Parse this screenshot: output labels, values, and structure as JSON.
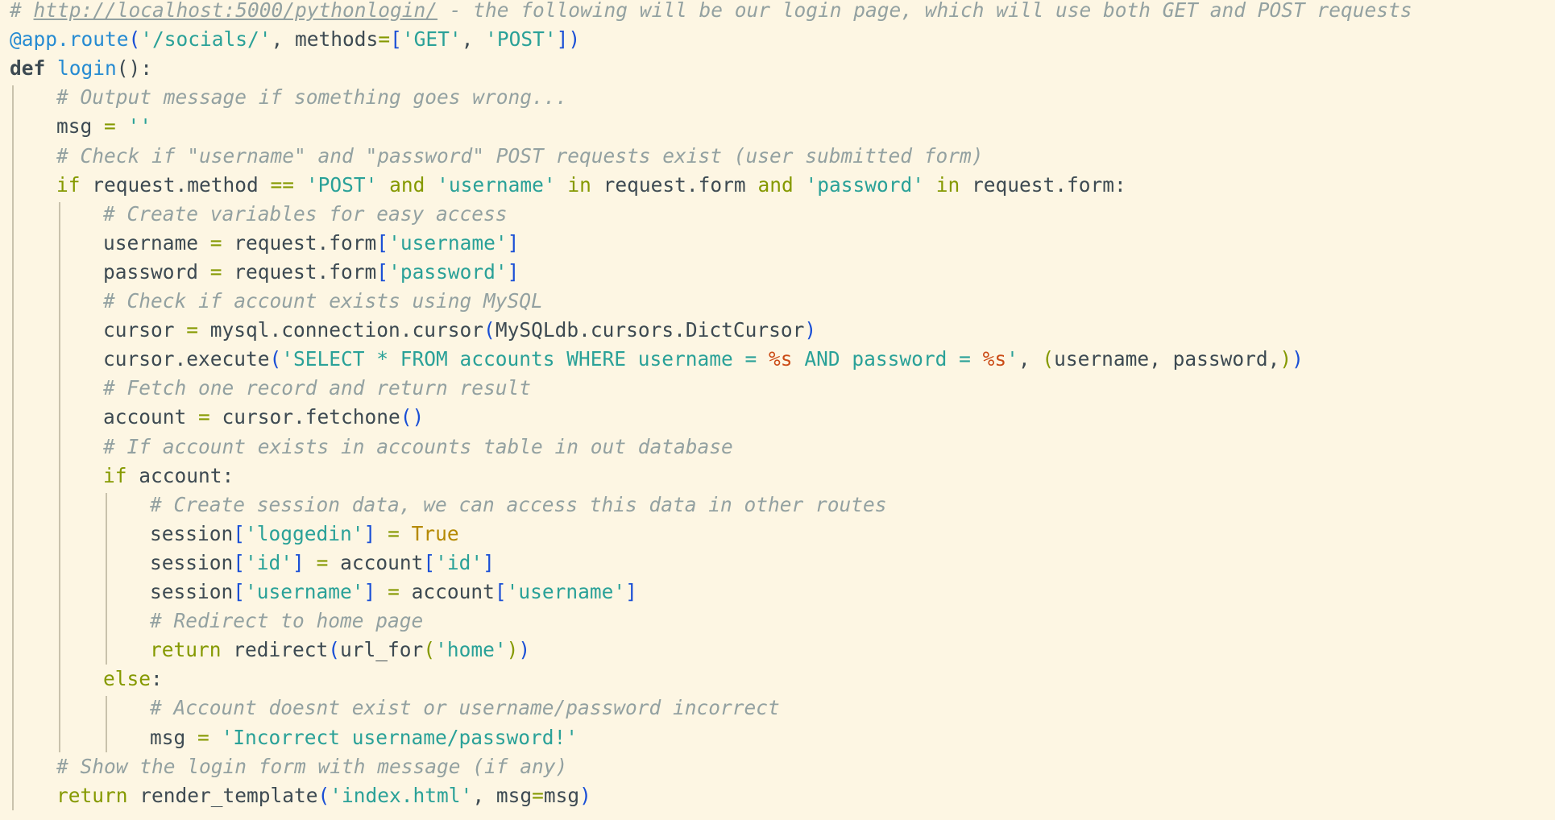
{
  "editor": {
    "language": "python",
    "theme": "solarized-light",
    "colors": {
      "background": "#fdf6e3",
      "comment": "#93a1a1",
      "keyword": "#859900",
      "string": "#2aa198",
      "function": "#268bd2",
      "format_specifier": "#cb4b16",
      "bracket": "#1a4fd6",
      "constant": "#b58900",
      "text": "#3d4a52",
      "indent_guide": "#c9c2ac"
    },
    "lines": [
      {
        "indent": 0,
        "tokens": [
          {
            "t": "# ",
            "c": "comment"
          },
          {
            "t": "http://localhost:5000/pythonlogin/",
            "c": "link"
          },
          {
            "t": " - the following will be our login page, which will use both GET and POST requests",
            "c": "comment"
          }
        ]
      },
      {
        "indent": 0,
        "tokens": [
          {
            "t": "@app.route",
            "c": "decorator"
          },
          {
            "t": "(",
            "c": "bracket"
          },
          {
            "t": "'/socials/'",
            "c": "string"
          },
          {
            "t": ", methods",
            "c": "plain"
          },
          {
            "t": "=",
            "c": "op"
          },
          {
            "t": "[",
            "c": "bracket"
          },
          {
            "t": "'GET'",
            "c": "string"
          },
          {
            "t": ", ",
            "c": "plain"
          },
          {
            "t": "'POST'",
            "c": "string"
          },
          {
            "t": "])",
            "c": "bracket"
          }
        ]
      },
      {
        "indent": 0,
        "tokens": [
          {
            "t": "def",
            "c": "keyword-bold"
          },
          {
            "t": " ",
            "c": "plain"
          },
          {
            "t": "login",
            "c": "func"
          },
          {
            "t": "():",
            "c": "plain"
          }
        ]
      },
      {
        "indent": 1,
        "tokens": [
          {
            "t": "# Output message if something goes wrong...",
            "c": "comment"
          }
        ]
      },
      {
        "indent": 1,
        "tokens": [
          {
            "t": "msg ",
            "c": "plain"
          },
          {
            "t": "=",
            "c": "op"
          },
          {
            "t": " ",
            "c": "plain"
          },
          {
            "t": "''",
            "c": "string"
          }
        ]
      },
      {
        "indent": 1,
        "tokens": [
          {
            "t": "# Check if \"username\" and \"password\" POST requests exist (user submitted form)",
            "c": "comment"
          }
        ]
      },
      {
        "indent": 1,
        "tokens": [
          {
            "t": "if",
            "c": "keyword"
          },
          {
            "t": " request.method ",
            "c": "plain"
          },
          {
            "t": "==",
            "c": "op"
          },
          {
            "t": " ",
            "c": "plain"
          },
          {
            "t": "'POST'",
            "c": "string"
          },
          {
            "t": " ",
            "c": "plain"
          },
          {
            "t": "and",
            "c": "keyword"
          },
          {
            "t": " ",
            "c": "plain"
          },
          {
            "t": "'username'",
            "c": "string"
          },
          {
            "t": " ",
            "c": "plain"
          },
          {
            "t": "in",
            "c": "keyword"
          },
          {
            "t": " request.form ",
            "c": "plain"
          },
          {
            "t": "and",
            "c": "keyword"
          },
          {
            "t": " ",
            "c": "plain"
          },
          {
            "t": "'password'",
            "c": "string"
          },
          {
            "t": " ",
            "c": "plain"
          },
          {
            "t": "in",
            "c": "keyword"
          },
          {
            "t": " request.form:",
            "c": "plain"
          }
        ]
      },
      {
        "indent": 2,
        "tokens": [
          {
            "t": "# Create variables for easy access",
            "c": "comment"
          }
        ]
      },
      {
        "indent": 2,
        "tokens": [
          {
            "t": "username ",
            "c": "plain"
          },
          {
            "t": "=",
            "c": "op"
          },
          {
            "t": " request.form",
            "c": "plain"
          },
          {
            "t": "[",
            "c": "bracket"
          },
          {
            "t": "'username'",
            "c": "string"
          },
          {
            "t": "]",
            "c": "bracket"
          }
        ]
      },
      {
        "indent": 2,
        "tokens": [
          {
            "t": "password ",
            "c": "plain"
          },
          {
            "t": "=",
            "c": "op"
          },
          {
            "t": " request.form",
            "c": "plain"
          },
          {
            "t": "[",
            "c": "bracket"
          },
          {
            "t": "'password'",
            "c": "string"
          },
          {
            "t": "]",
            "c": "bracket"
          }
        ]
      },
      {
        "indent": 2,
        "tokens": [
          {
            "t": "# Check if account exists using MySQL",
            "c": "comment"
          }
        ]
      },
      {
        "indent": 2,
        "tokens": [
          {
            "t": "cursor ",
            "c": "plain"
          },
          {
            "t": "=",
            "c": "op"
          },
          {
            "t": " mysql.connection.cursor",
            "c": "plain"
          },
          {
            "t": "(",
            "c": "bracket"
          },
          {
            "t": "MySQLdb.cursors.DictCursor",
            "c": "plain"
          },
          {
            "t": ")",
            "c": "bracket"
          }
        ]
      },
      {
        "indent": 2,
        "tokens": [
          {
            "t": "cursor.execute",
            "c": "plain"
          },
          {
            "t": "(",
            "c": "bracket"
          },
          {
            "t": "'SELECT * FROM accounts WHERE username = ",
            "c": "string"
          },
          {
            "t": "%s",
            "c": "format"
          },
          {
            "t": " AND password = ",
            "c": "string"
          },
          {
            "t": "%s",
            "c": "format"
          },
          {
            "t": "'",
            "c": "string"
          },
          {
            "t": ", ",
            "c": "plain"
          },
          {
            "t": "(",
            "c": "keyword"
          },
          {
            "t": "username, password,",
            "c": "plain"
          },
          {
            "t": ")",
            "c": "keyword"
          },
          {
            "t": ")",
            "c": "bracket"
          }
        ]
      },
      {
        "indent": 2,
        "tokens": [
          {
            "t": "# Fetch one record and return result",
            "c": "comment"
          }
        ]
      },
      {
        "indent": 2,
        "tokens": [
          {
            "t": "account ",
            "c": "plain"
          },
          {
            "t": "=",
            "c": "op"
          },
          {
            "t": " cursor.fetchone",
            "c": "plain"
          },
          {
            "t": "()",
            "c": "bracket"
          }
        ]
      },
      {
        "indent": 2,
        "tokens": [
          {
            "t": "# If account exists in accounts table in out database",
            "c": "comment"
          }
        ]
      },
      {
        "indent": 2,
        "tokens": [
          {
            "t": "if",
            "c": "keyword"
          },
          {
            "t": " account:",
            "c": "plain"
          }
        ]
      },
      {
        "indent": 3,
        "tokens": [
          {
            "t": "# Create session data, we can access this data in other routes",
            "c": "comment"
          }
        ]
      },
      {
        "indent": 3,
        "tokens": [
          {
            "t": "session",
            "c": "plain"
          },
          {
            "t": "[",
            "c": "bracket"
          },
          {
            "t": "'loggedin'",
            "c": "string"
          },
          {
            "t": "]",
            "c": "bracket"
          },
          {
            "t": " ",
            "c": "plain"
          },
          {
            "t": "=",
            "c": "op"
          },
          {
            "t": " ",
            "c": "plain"
          },
          {
            "t": "True",
            "c": "const"
          }
        ]
      },
      {
        "indent": 3,
        "tokens": [
          {
            "t": "session",
            "c": "plain"
          },
          {
            "t": "[",
            "c": "bracket"
          },
          {
            "t": "'id'",
            "c": "string"
          },
          {
            "t": "]",
            "c": "bracket"
          },
          {
            "t": " ",
            "c": "plain"
          },
          {
            "t": "=",
            "c": "op"
          },
          {
            "t": " account",
            "c": "plain"
          },
          {
            "t": "[",
            "c": "bracket"
          },
          {
            "t": "'id'",
            "c": "string"
          },
          {
            "t": "]",
            "c": "bracket"
          }
        ]
      },
      {
        "indent": 3,
        "tokens": [
          {
            "t": "session",
            "c": "plain"
          },
          {
            "t": "[",
            "c": "bracket"
          },
          {
            "t": "'username'",
            "c": "string"
          },
          {
            "t": "]",
            "c": "bracket"
          },
          {
            "t": " ",
            "c": "plain"
          },
          {
            "t": "=",
            "c": "op"
          },
          {
            "t": " account",
            "c": "plain"
          },
          {
            "t": "[",
            "c": "bracket"
          },
          {
            "t": "'username'",
            "c": "string"
          },
          {
            "t": "]",
            "c": "bracket"
          }
        ]
      },
      {
        "indent": 3,
        "tokens": [
          {
            "t": "# Redirect to home page",
            "c": "comment"
          }
        ]
      },
      {
        "indent": 3,
        "tokens": [
          {
            "t": "return",
            "c": "keyword"
          },
          {
            "t": " redirect",
            "c": "plain"
          },
          {
            "t": "(",
            "c": "bracket"
          },
          {
            "t": "url_for",
            "c": "plain"
          },
          {
            "t": "(",
            "c": "keyword"
          },
          {
            "t": "'home'",
            "c": "string"
          },
          {
            "t": ")",
            "c": "keyword"
          },
          {
            "t": ")",
            "c": "bracket"
          }
        ]
      },
      {
        "indent": 2,
        "tokens": [
          {
            "t": "else",
            "c": "keyword"
          },
          {
            "t": ":",
            "c": "plain"
          }
        ]
      },
      {
        "indent": 3,
        "tokens": [
          {
            "t": "# Account doesnt exist or username/password incorrect",
            "c": "comment"
          }
        ]
      },
      {
        "indent": 3,
        "tokens": [
          {
            "t": "msg ",
            "c": "plain"
          },
          {
            "t": "=",
            "c": "op"
          },
          {
            "t": " ",
            "c": "plain"
          },
          {
            "t": "'Incorrect username/password!'",
            "c": "string"
          }
        ]
      },
      {
        "indent": 1,
        "tokens": [
          {
            "t": "# Show the login form with message (if any)",
            "c": "comment"
          }
        ]
      },
      {
        "indent": 1,
        "tokens": [
          {
            "t": "return",
            "c": "keyword"
          },
          {
            "t": " render_template",
            "c": "plain"
          },
          {
            "t": "(",
            "c": "bracket"
          },
          {
            "t": "'index.html'",
            "c": "string"
          },
          {
            "t": ", msg",
            "c": "plain"
          },
          {
            "t": "=",
            "c": "op"
          },
          {
            "t": "msg",
            "c": "plain"
          },
          {
            "t": ")",
            "c": "bracket"
          }
        ]
      }
    ]
  }
}
